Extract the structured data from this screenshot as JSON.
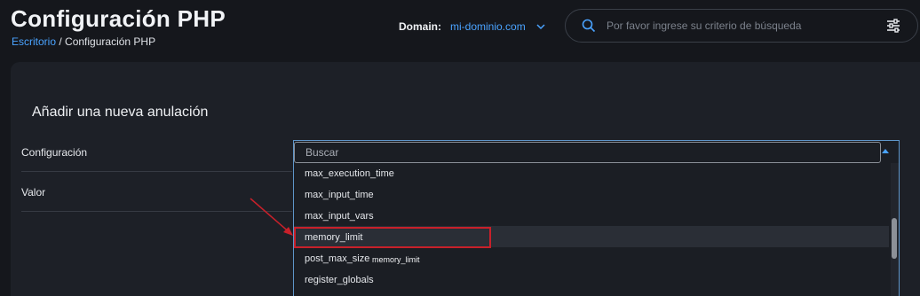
{
  "header": {
    "title": "Configuración PHP",
    "breadcrumb": {
      "link": "Escritorio",
      "separator": "/",
      "current": "Configuración PHP"
    },
    "domain": {
      "label": "Domain:",
      "value": "mi-dominio.com"
    },
    "search": {
      "placeholder": "Por favor ingrese su criterio de búsqueda"
    }
  },
  "form": {
    "title": "Añadir una nueva anulación",
    "config_label": "Configuración",
    "value_label": "Valor",
    "dropdown": {
      "search_placeholder": "Buscar",
      "options": [
        "max_execution_time",
        "max_input_time",
        "max_input_vars",
        "memory_limit",
        "post_max_size",
        "register_globals"
      ],
      "highlighted": "memory_limit",
      "tooltip": "memory_limit"
    }
  },
  "colors": {
    "accent": "#4aa3ff",
    "annotation": "#c8202a"
  },
  "icons": [
    "chevron-down-icon",
    "search-icon",
    "filter-sliders-icon",
    "caret-up-icon",
    "annotation-arrow"
  ]
}
